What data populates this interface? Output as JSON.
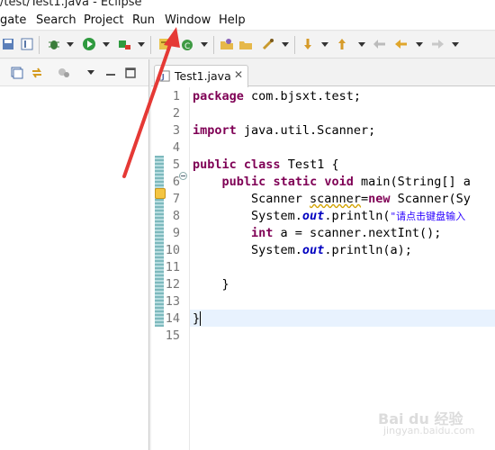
{
  "window": {
    "title": "/test/Test1.java - Eclipse"
  },
  "menu": {
    "items": [
      {
        "label": "gate"
      },
      {
        "label": "Search"
      },
      {
        "label": "Project"
      },
      {
        "label": "Run"
      },
      {
        "label": "Window"
      },
      {
        "label": "Help"
      }
    ]
  },
  "editor": {
    "tab_label": "Test1.java",
    "tab_close": "✕",
    "line_numbers": [
      "1",
      "2",
      "3",
      "4",
      "5",
      "6",
      "7",
      "8",
      "9",
      "10",
      "11",
      "12",
      "13",
      "14",
      "15"
    ],
    "code": {
      "l1_kw": "package",
      "l1_rest": " com.bjsxt.test;",
      "l3_kw": "import",
      "l3_rest": " java.util.Scanner;",
      "l5_kw1": "public",
      "l5_sp": " ",
      "l5_kw2": "class",
      "l5_rest": " Test1 {",
      "l6_indent": "    ",
      "l6_kw1": "public",
      "l6_kw2": "static",
      "l6_kw3": "void",
      "l6_rest": " main(String[] a",
      "l7_indent": "        Scanner ",
      "l7_var": "scanner",
      "l7_mid": "=",
      "l7_kw": "new",
      "l7_rest": " Scanner(Sy",
      "l8_pre": "        System.",
      "l8_fld": "out",
      "l8_mid": ".println(",
      "l8_str": "\"请点击键盘输入",
      "l9_indent": "        ",
      "l9_kw": "int",
      "l9_rest": " a = scanner.nextInt();",
      "l10_pre": "        System.",
      "l10_fld": "out",
      "l10_rest": ".println(a);",
      "l12": "    }",
      "l14": "}"
    }
  },
  "watermark": {
    "line1": "Bai du 经验",
    "line2": "jingyan.baidu.com"
  },
  "colors": {
    "keyword": "#7f0055",
    "field": "#0000c0",
    "string": "#2a00ff",
    "annotation_arrow": "#e53935"
  }
}
